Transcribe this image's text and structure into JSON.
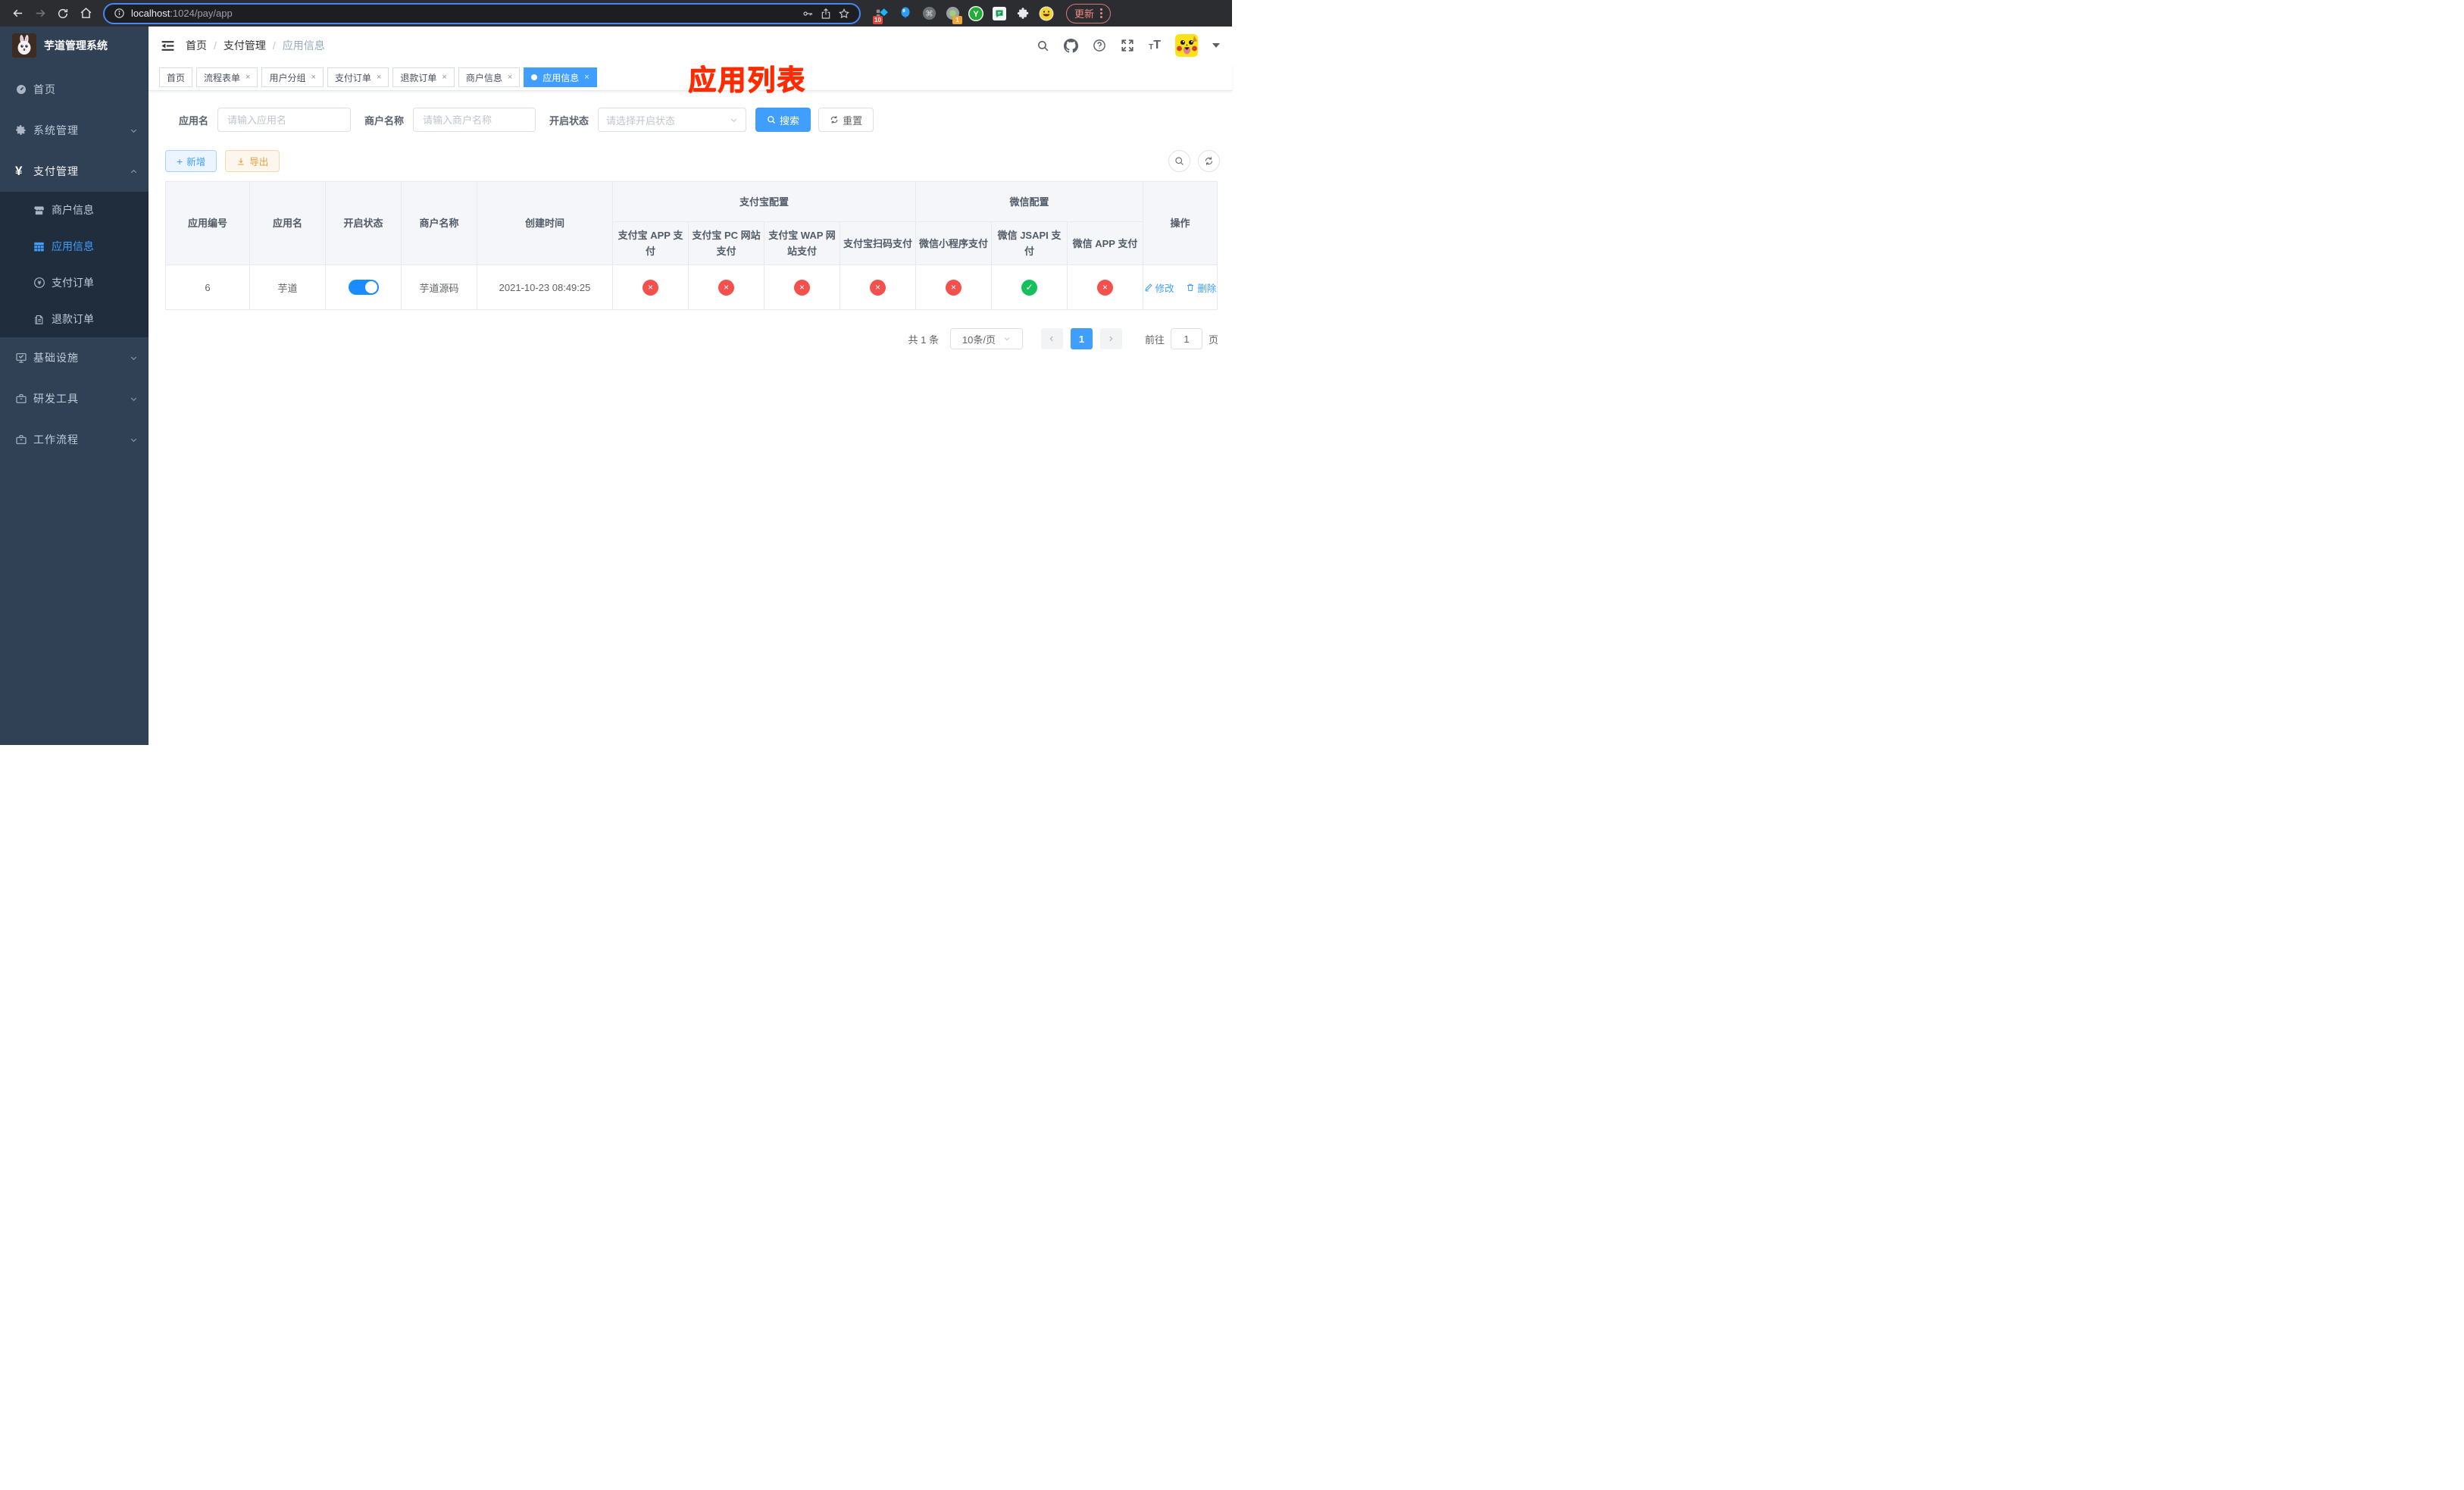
{
  "browser": {
    "url": {
      "host": "localhost",
      "rest": ":1024/pay/app"
    },
    "update_label": "更新",
    "ext_badges": {
      "tasks": "10",
      "notify": "1"
    }
  },
  "colors": {
    "primary": "#409eff",
    "success": "#16c05f",
    "danger": "#f4504d",
    "warning": "#e6a23c",
    "annotation_red": "#ff2b00",
    "sidebar_bg": "#304156",
    "submenu_bg": "#1f2d3d"
  },
  "sidebar": {
    "logo_title": "芋道管理系统",
    "menu": [
      {
        "label": "首页"
      },
      {
        "label": "系统管理"
      },
      {
        "label": "支付管理"
      },
      {
        "label": "商户信息"
      },
      {
        "label": "应用信息"
      },
      {
        "label": "支付订单"
      },
      {
        "label": "退款订单"
      },
      {
        "label": "基础设施"
      },
      {
        "label": "研发工具"
      },
      {
        "label": "工作流程"
      }
    ]
  },
  "header": {
    "breadcrumb": [
      "首页",
      "支付管理",
      "应用信息"
    ],
    "annotation": "应用列表"
  },
  "tabs": [
    {
      "label": "首页"
    },
    {
      "label": "流程表单"
    },
    {
      "label": "用户分组"
    },
    {
      "label": "支付订单"
    },
    {
      "label": "退款订单"
    },
    {
      "label": "商户信息"
    },
    {
      "label": "应用信息"
    }
  ],
  "filters": {
    "app_name": {
      "label": "应用名",
      "placeholder": "请输入应用名"
    },
    "merchant_name": {
      "label": "商户名称",
      "placeholder": "请输入商户名称"
    },
    "status": {
      "label": "开启状态",
      "placeholder": "请选择开启状态"
    },
    "search_label": "搜索",
    "reset_label": "重置"
  },
  "toolbar": {
    "add_label": "新增",
    "export_label": "导出"
  },
  "table": {
    "groups": {
      "alipay": "支付宝配置",
      "wechat": "微信配置"
    },
    "columns": [
      "应用编号",
      "应用名",
      "开启状态",
      "商户名称",
      "创建时间",
      "支付宝 APP 支付",
      "支付宝 PC 网站支付",
      "支付宝 WAP 网站支付",
      "支付宝扫码支付",
      "微信小程序支付",
      "微信 JSAPI 支付",
      "微信 APP 支付",
      "操作"
    ],
    "row": {
      "id": "6",
      "name": "芋道",
      "enabled": true,
      "merchant": "芋道源码",
      "created": "2021-10-23 08:49:25",
      "statuses": [
        "no",
        "no",
        "no",
        "no",
        "no",
        "yes",
        "no"
      ],
      "edit_label": "修改",
      "delete_label": "删除"
    }
  },
  "pagination": {
    "total": "共 1 条",
    "page_size": "10条/页",
    "page": "1",
    "goto_label": "前往",
    "goto_value": "1",
    "unit_label": "页"
  }
}
